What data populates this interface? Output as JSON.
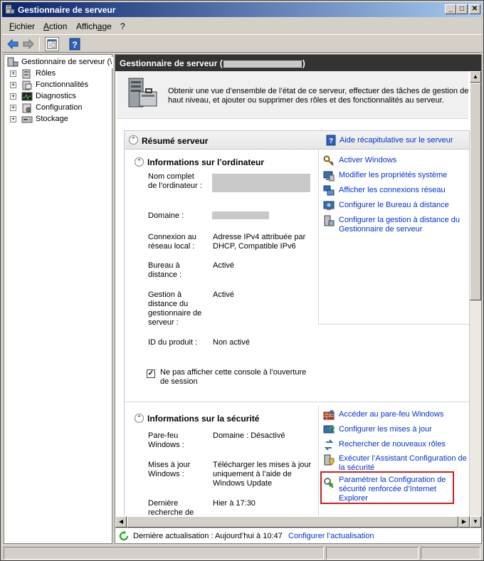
{
  "window": {
    "title": "Gestionnaire de serveur"
  },
  "menu": [
    "Fichier",
    "Action",
    "Affichage",
    "?"
  ],
  "icons": {
    "app": "server-manager-icon",
    "back": "back-arrow-icon",
    "forward": "forward-arrow-icon",
    "console_tree": "console-tree-icon",
    "help": "help-icon"
  },
  "tree": {
    "root": "Gestionnaire de serveur (\\",
    "items": [
      "Rôles",
      "Fonctionnalités",
      "Diagnostics",
      "Configuration",
      "Stockage"
    ]
  },
  "header": {
    "title_prefix": "Gestionnaire de serveur (",
    "title_suffix": ")"
  },
  "intro": "Obtenir une vue d’ensemble de l’état de ce serveur, effectuer des tâches de gestion de haut niveau, et ajouter ou supprimer des rôles et des fonctionnalités au serveur.",
  "summary": {
    "title": "Résumé serveur",
    "help_link": "Aide récapitulative sur le serveur"
  },
  "computer_info": {
    "title": "Informations sur l’ordinateur",
    "fields": [
      {
        "label": "Nom complet de l’ordinateur :",
        "value": ""
      },
      {
        "label": "Domaine :",
        "value": ""
      },
      {
        "label": "Connexion au réseau local :",
        "value": "Adresse IPv4 attribuée par DHCP, Compatible IPv6"
      },
      {
        "label": "Bureau à distance :",
        "value": "Activé"
      },
      {
        "label": "Gestion à distance du gestionnaire de serveur :",
        "value": "Activé"
      },
      {
        "label": "ID du produit :",
        "value": "Non activé"
      }
    ],
    "checkbox_label": "Ne pas afficher cette console à l’ouverture de session",
    "checkbox_checked": true,
    "actions": [
      "Activer Windows",
      "Modifier les propriétés système",
      "Afficher les connexions réseau",
      "Configurer le Bureau à distance",
      "Configurer la gestion à distance du Gestionnaire de serveur"
    ]
  },
  "security_info": {
    "title": "Informations sur la sécurité",
    "fields": [
      {
        "label": "Pare-feu Windows :",
        "value": "Domaine : Désactivé"
      },
      {
        "label": "Mises à jour Windows :",
        "value": "Télécharger les mises à jour uniquement à l’aide de Windows Update"
      },
      {
        "label": "Dernière recherche de",
        "value": "Hier à 17:30"
      }
    ],
    "actions": [
      "Accéder au pare-feu Windows",
      "Configurer les mises à jour",
      "Rechercher de nouveaux rôles",
      "Exécuter l’Assistant Configuration de la sécurité",
      "Paramétrer la Configuration de sécurité renforcée d’Internet Explorer"
    ],
    "highlight_color": "#d01c1c"
  },
  "footer": {
    "refresh_text": "Dernière actualisation : Aujourd’hui à 10:47",
    "refresh_link": "Configurer l’actualisation"
  }
}
